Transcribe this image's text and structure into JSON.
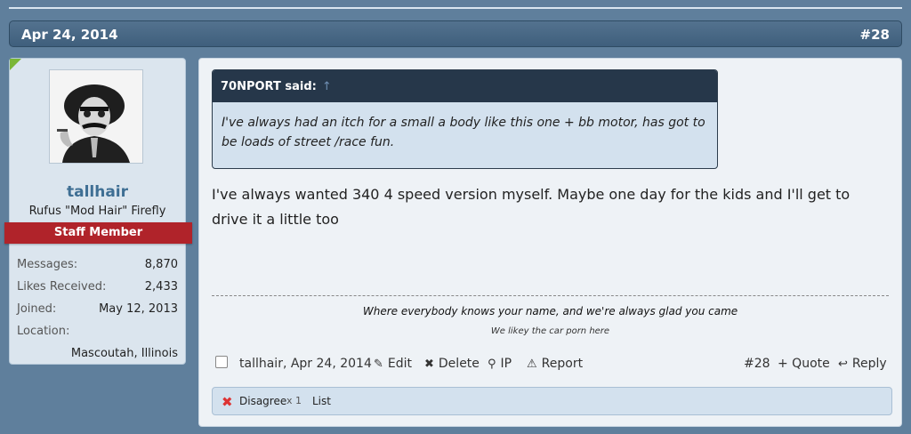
{
  "post": {
    "date": "Apr 24, 2014",
    "number": "#28"
  },
  "user": {
    "name": "tallhair",
    "title": "Rufus \"Mod Hair\" Firefly",
    "banner": "Staff Member",
    "stats": [
      {
        "label": "Messages:",
        "value": "8,870"
      },
      {
        "label": "Likes Received:",
        "value": "2,433"
      },
      {
        "label": "Joined:",
        "value": "May 12, 2013"
      }
    ],
    "location_label": "Location:",
    "location_value": "Mascoutah, Illinois"
  },
  "quote": {
    "author": "70NPORT said:",
    "arrow": "↑",
    "text": "I've always had an itch for a small a body like this one + bb motor, has got to be loads of street /race fun."
  },
  "message": "I've always wanted 340 4 speed version myself. Maybe one day for the kids and I'll get to drive it a little too",
  "signature": {
    "line1": "Where everybody knows your name, and we're always glad you came",
    "line2": "We likey the car porn here"
  },
  "meta": {
    "author_date": "tallhair, Apr 24, 2014",
    "edit": "Edit",
    "delete": "Delete",
    "ip": "IP",
    "report": "Report",
    "post_number": "#28",
    "quote": "+ Quote",
    "reply": "Reply"
  },
  "likes": {
    "label": "Disagree",
    "count": "x 1",
    "list": "List"
  },
  "colors": {
    "background": "#5f7f9c",
    "staff_banner": "#b0232a",
    "username": "#3f6f94",
    "quote_header": "#26374a"
  }
}
